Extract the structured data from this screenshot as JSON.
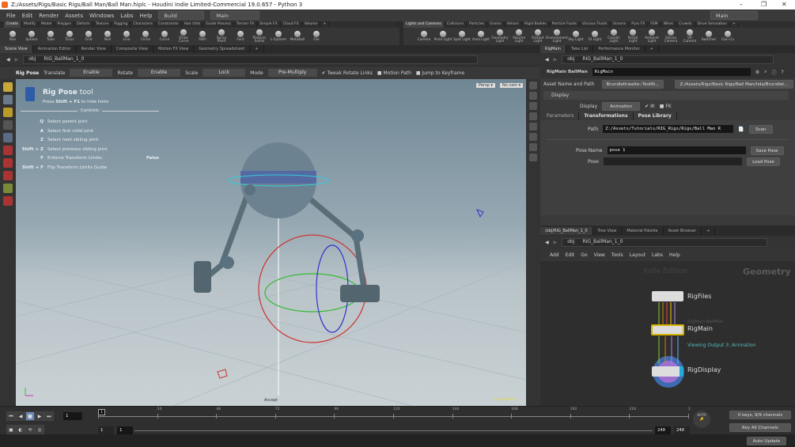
{
  "window": {
    "title": "Z:/Assets/Rigs/Basic Rigs/Ball Man/Ball Man.hiplc - Houdini Indie Limited-Commercial 19.0.657 - Python 3",
    "minimize": "–",
    "maximize": "❐",
    "close": "✕"
  },
  "menu": {
    "items": [
      "File",
      "Edit",
      "Render",
      "Assets",
      "Windows",
      "Labs",
      "Help"
    ],
    "desktop": "Build",
    "context": "Main",
    "right_desktop": "Main"
  },
  "shelf_tabs_left": [
    "Create",
    "Modify",
    "Model",
    "Polygon",
    "Deform",
    "Texture",
    "Rigging",
    "Characters",
    "Constraints",
    "Hair Utils",
    "Guide Process",
    "Terrain FX",
    "Simple FX",
    "Cloud FX",
    "Volume",
    "+"
  ],
  "shelf_tabs_right": [
    "Lights and Cameras",
    "Collisions",
    "Particles",
    "Grains",
    "Vellum",
    "Rigid Bodies",
    "Particle Fluids",
    "Viscous Fluids",
    "Oceans",
    "Pyro FX",
    "FEM",
    "Wires",
    "Crowds",
    "Drive Simulation",
    "+"
  ],
  "shelf_tools_left": [
    "Box",
    "Sphere",
    "Tube",
    "Torus",
    "Grid",
    "Null",
    "Line",
    "Circle",
    "Curve",
    "Draw Curve",
    "Path",
    "Spray Paint",
    "Font",
    "Platonic Solids",
    "L-System",
    "Metaball",
    "File"
  ],
  "shelf_tools_right": [
    "Camera",
    "Point Light",
    "Spot Light",
    "Area Light",
    "Geometry Light",
    "Volume Light",
    "Distant Light",
    "Environment Light",
    "Sky Light",
    "GI Light",
    "Caustic Light",
    "Portal Light",
    "Ambient Light",
    "Stereo Camera",
    "VR Camera",
    "Switcher",
    "Gan Ca"
  ],
  "left_pane_tabs": [
    "Scene View",
    "Animation Editor",
    "Render View",
    "Composite View",
    "Motion FX View",
    "Geometry Spreadsheet",
    "+"
  ],
  "right_pane_tabs": [
    "RigMain",
    "Take List",
    "Performance Monitor",
    "+"
  ],
  "path": {
    "root": "obj",
    "node": "RIG_BallMan_1_0"
  },
  "tool_options": {
    "tool": "Rig Pose",
    "translate_label": "Translate",
    "translate": "Enable",
    "rotate_label": "Rotate",
    "rotate": "Enable",
    "scale_label": "Scale",
    "scale": "Lock",
    "mode_label": "Mode",
    "mode": "Pre-Multiply",
    "tweak": "Tweak Rotate Links",
    "motion_path": "Motion Path",
    "jump": "Jump to Keyframe"
  },
  "viewport": {
    "persp": "Persp ▾",
    "cam": "No cam ▾",
    "accept": "Accept",
    "edition": "Indie Edition",
    "hint": {
      "title_bold": "Rig Pose",
      "title_rest": " tool",
      "sub_pre": "Press ",
      "sub_key": "Shift + F1",
      "sub_post": " to hide hints",
      "controls": "Controls",
      "rows": [
        {
          "key": "Q",
          "desc": "Select parent joint"
        },
        {
          "key": "A",
          "desc": "Select first child joint"
        },
        {
          "key": "Z",
          "desc": "Select next sibling joint"
        },
        {
          "key": "Shift + Z",
          "desc": "Select previous sibling joint"
        },
        {
          "key": "F",
          "desc": "Enforce Transform Limits:",
          "val": "False"
        },
        {
          "key": "Shift + F",
          "desc": "Flip Transform Limits Guide"
        }
      ]
    }
  },
  "params": {
    "node_type": "RigMain BallMan",
    "node_name": "RigMain",
    "asset_label": "Asset Name and Path",
    "asset_name": "Brundlethwaite::TestRi...",
    "asset_path": "Z:/Assets/Rigs/Basic Rigs/Ball Man/hda/Brundlet...",
    "display_section": "Display",
    "display_label": "Display",
    "display": "Animation",
    "ik": "IK",
    "fk": "FK",
    "tabs": [
      "Parameters",
      "Transformations",
      "Pose Library"
    ],
    "path_label": "Path",
    "path": "Z:/Assets/Tutorials/RIG_Rigs/Rigs/Ball Man R",
    "scan": "Scan",
    "pose_name_label": "Pose Name",
    "pose_name": "pose 1",
    "save_pose": "Save Pose",
    "pose_label": "Pose",
    "pose": "",
    "load_pose": "Load Pose"
  },
  "network_tabs": [
    "/obj/RIG_BallMan_1_0",
    "Tree View",
    "Material Palette",
    "Asset Browser",
    "+"
  ],
  "network_menu": [
    "Add",
    "Edit",
    "Go",
    "View",
    "Tools",
    "Layout",
    "Labs",
    "Help"
  ],
  "network": {
    "watermark": "Indie Edition",
    "context": "Geometry",
    "nodes": [
      {
        "name": "RigFiles"
      },
      {
        "name": "RigMain",
        "type": "RigMain BallMan",
        "status": "Viewing Output 3: Animation"
      },
      {
        "name": "RigDisplay"
      }
    ]
  },
  "timeline": {
    "frame": "1",
    "start": "1",
    "start2": "1",
    "end": "240",
    "end2": "240",
    "ticks": [
      "1",
      "24",
      "48",
      "72",
      "96",
      "120",
      "144",
      "168",
      "192",
      "216",
      "2"
    ],
    "keys": "0 keys, 9/9 channels",
    "key_mode": "Key All Channels",
    "auto": "AUTO"
  },
  "status": {
    "update": "Auto Update"
  }
}
